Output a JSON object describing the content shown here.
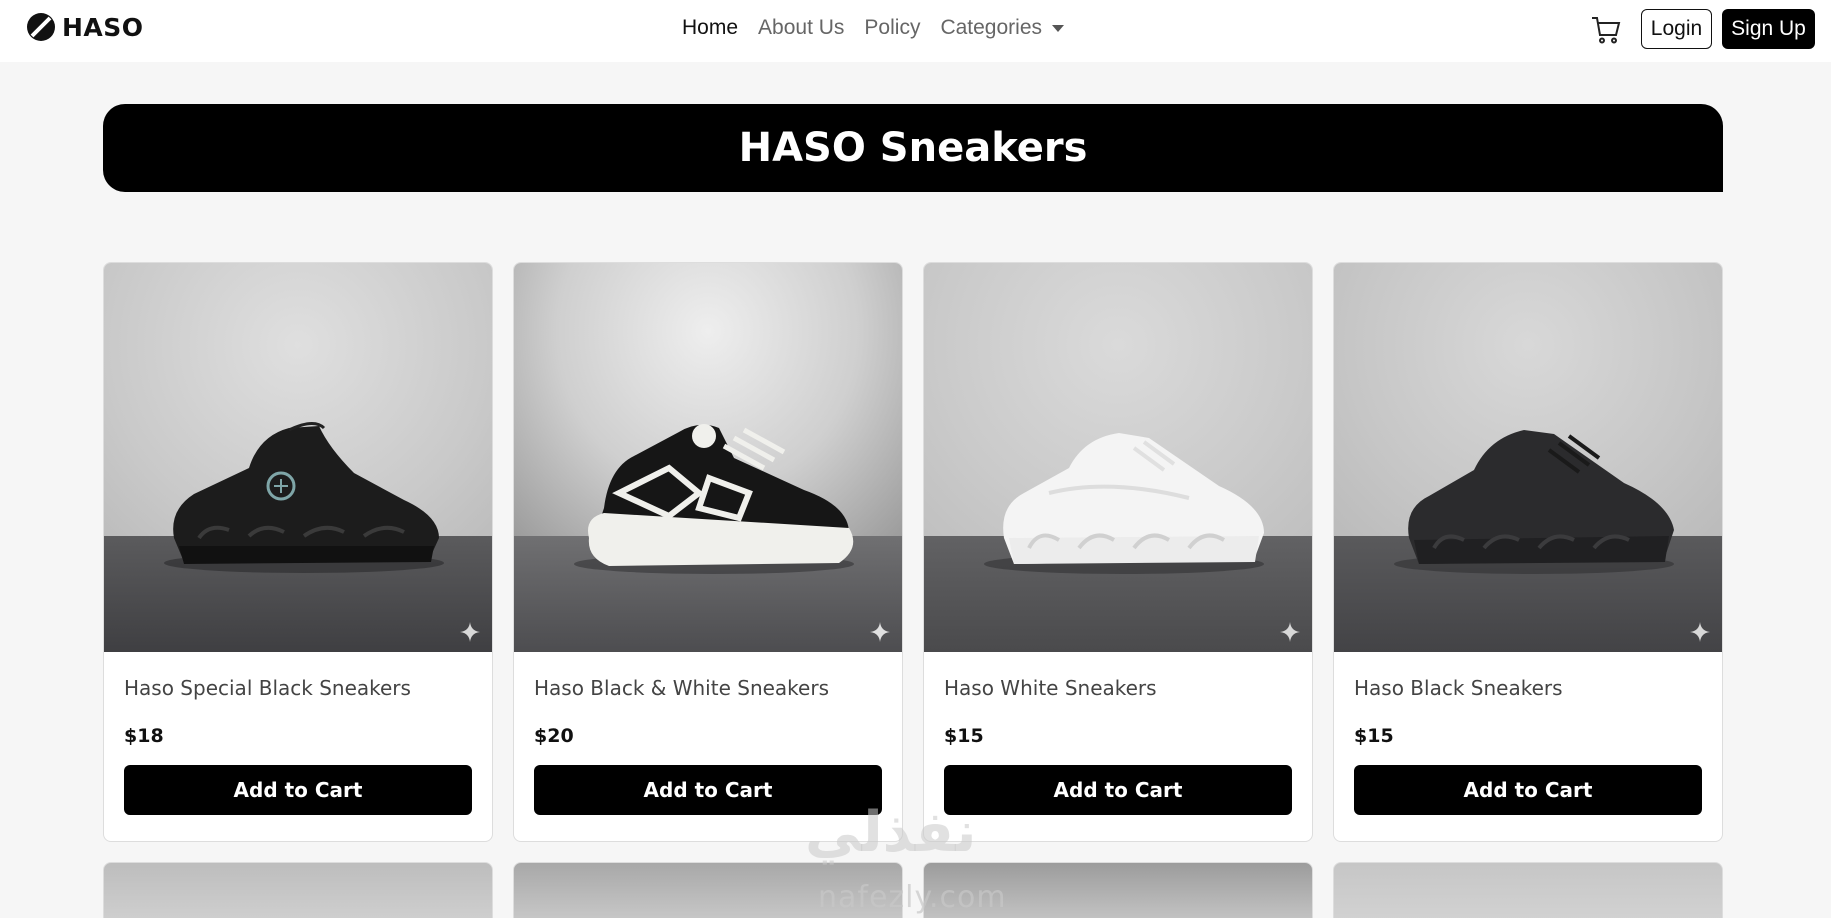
{
  "brand": {
    "name": "HASO"
  },
  "nav": {
    "links": [
      "Home",
      "About Us",
      "Policy"
    ],
    "categories_label": "Categories"
  },
  "actions": {
    "login": "Login",
    "signup": "Sign Up"
  },
  "hero": {
    "title": "HASO Sneakers"
  },
  "products": [
    {
      "title": "Haso Special Black Sneakers",
      "price": "$18",
      "button": "Add to Cart"
    },
    {
      "title": "Haso Black & White Sneakers",
      "price": "$20",
      "button": "Add to Cart"
    },
    {
      "title": "Haso White Sneakers",
      "price": "$15",
      "button": "Add to Cart"
    },
    {
      "title": "Haso Black Sneakers",
      "price": "$15",
      "button": "Add to Cart"
    }
  ],
  "watermark": {
    "arabic": "نفذلي",
    "latin": "nafezly.com"
  },
  "colors": {
    "primary": "#000000",
    "background": "#f6f6f6",
    "surface": "#ffffff"
  },
  "icons": [
    "haso-logo-icon",
    "cart-icon",
    "chevron-down-icon",
    "sparkle-icon"
  ]
}
